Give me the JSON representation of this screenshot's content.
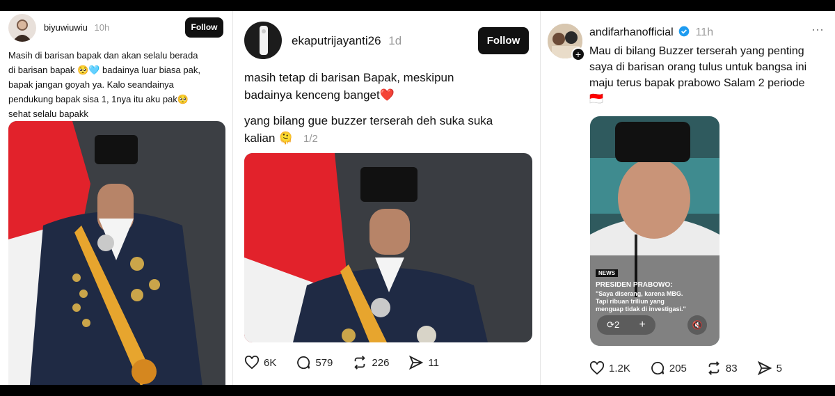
{
  "posts": [
    {
      "username": "biyuwiuwiu",
      "time": "10h",
      "follow_label": "Follow",
      "lines": [
        "Masih di barisan bapak dan akan selalu berada",
        "di barisan bapak 🥺🩵 badainya luar biasa pak,",
        "bapak jangan goyah ya. Kalo seandainya",
        "pendukung bapak sisa 1, 1nya itu aku pak🥺",
        "sehat selalu bapakk"
      ]
    },
    {
      "username": "ekaputrijayanti26",
      "time": "1d",
      "follow_label": "Follow",
      "para1": [
        "masih tetap di barisan Bapak, meskipun",
        "badainya kenceng banget❤️"
      ],
      "para2": [
        "yang bilang gue buzzer terserah deh suka suka",
        "kalian 🫠"
      ],
      "page_indicator": "1/2",
      "stats": {
        "likes": "6K",
        "comments": "579",
        "reposts": "226",
        "shares": "11"
      }
    },
    {
      "username": "andifarhanofficial",
      "time": "11h",
      "more": "···",
      "lines": [
        "Mau di bilang Buzzer terserah yang penting",
        "saya di barisan orang tulus untuk bangsa ini",
        "maju terus bapak prabowo Salam 2 periode",
        "🇮🇩"
      ],
      "video": {
        "tag": "NEWS",
        "headline": "PRESIDEN PRABOWO:",
        "quote_lines": [
          "\"Saya diserang, karena MBG.",
          "Tapi ribuan triliun yang",
          "menguap tidak di investigasi.\""
        ],
        "repost_count": "2"
      },
      "stats": {
        "likes": "1.2K",
        "comments": "205",
        "reposts": "83",
        "shares": "5"
      }
    }
  ],
  "colors": {
    "follow_bg": "#111111",
    "verified": "#1d9bf0",
    "flag_red": "#e8202a",
    "backdrop": "#3a3d42"
  }
}
